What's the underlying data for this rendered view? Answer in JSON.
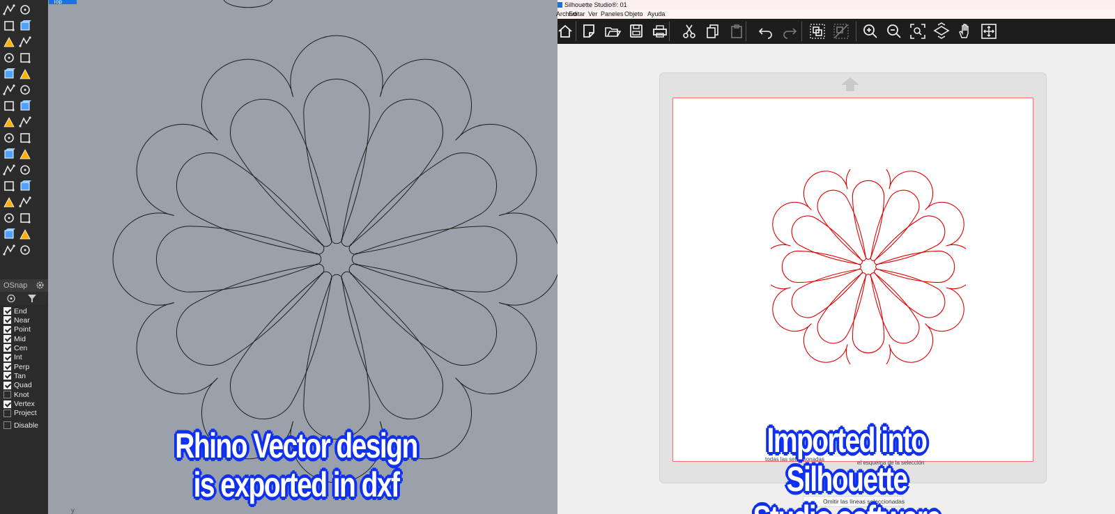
{
  "rhino": {
    "viewport_tab": "Top",
    "viewport_axis_label": "y",
    "osnap": {
      "header": "OSnap",
      "items": [
        {
          "label": "End",
          "checked": true
        },
        {
          "label": "Near",
          "checked": true
        },
        {
          "label": "Point",
          "checked": true
        },
        {
          "label": "Mid",
          "checked": true
        },
        {
          "label": "Cen",
          "checked": true
        },
        {
          "label": "Int",
          "checked": true
        },
        {
          "label": "Perp",
          "checked": true
        },
        {
          "label": "Tan",
          "checked": true
        },
        {
          "label": "Quad",
          "checked": true
        },
        {
          "label": "Knot",
          "checked": false
        },
        {
          "label": "Vertex",
          "checked": true
        },
        {
          "label": "Project",
          "checked": false
        }
      ],
      "disable_label": "Disable",
      "disable_checked": false
    },
    "toolbar_icons": [
      "select-arrow-icon",
      "point-icon",
      "polyline-icon",
      "curve-icon",
      "circle-icon",
      "ellipse-icon",
      "polygon-icon",
      "rectangle-icon",
      "arc-icon",
      "fillet-icon",
      "transform-icon",
      "rotate-icon",
      "box-icon",
      "boolean-icon",
      "cylinder-icon",
      "surface-icon",
      "explode-icon",
      "light-icon",
      "dimension-icon",
      "mesh-icon",
      "render-icon",
      "group-icon",
      "curve-tool-icon",
      "blend-icon",
      "text-icon",
      "snap-icon",
      "array-icon",
      "edit-icon",
      "solid-icon",
      "grid-icon",
      "layout-icon",
      "split-icon",
      "more-icon"
    ],
    "background_color": "#9aa1ab",
    "curve_color": "#1e1e1e"
  },
  "silhouette": {
    "title": "Silhouette Studio®: 01",
    "menu": [
      "Archivo",
      "Editar",
      "Ver",
      "Paneles",
      "Objeto",
      "Ayuda"
    ],
    "toolbar_icons": [
      "home-icon",
      "new-page-icon",
      "open-folder-icon",
      "save-icon",
      "print-icon",
      "cut-icon",
      "copy-icon",
      "paste-icon",
      "undo-icon",
      "redo-icon",
      "group-icon",
      "ungroup-icon",
      "zoom-in-icon",
      "zoom-out-icon",
      "zoom-fit-icon",
      "zoom-page-icon",
      "pan-hand-icon",
      "move-icon"
    ],
    "status_a": "todas las seleccionadas",
    "status_b": "el esquema de la selección",
    "bottom_button": "Omitir las líneas seleccionadas",
    "cut_line_color": "#e00000"
  },
  "captions": {
    "left_line1": "Rhino Vector design",
    "left_line2": "is exported in dxf",
    "right_line1": "Imported into Silhouette",
    "right_line2": "Studio software"
  }
}
